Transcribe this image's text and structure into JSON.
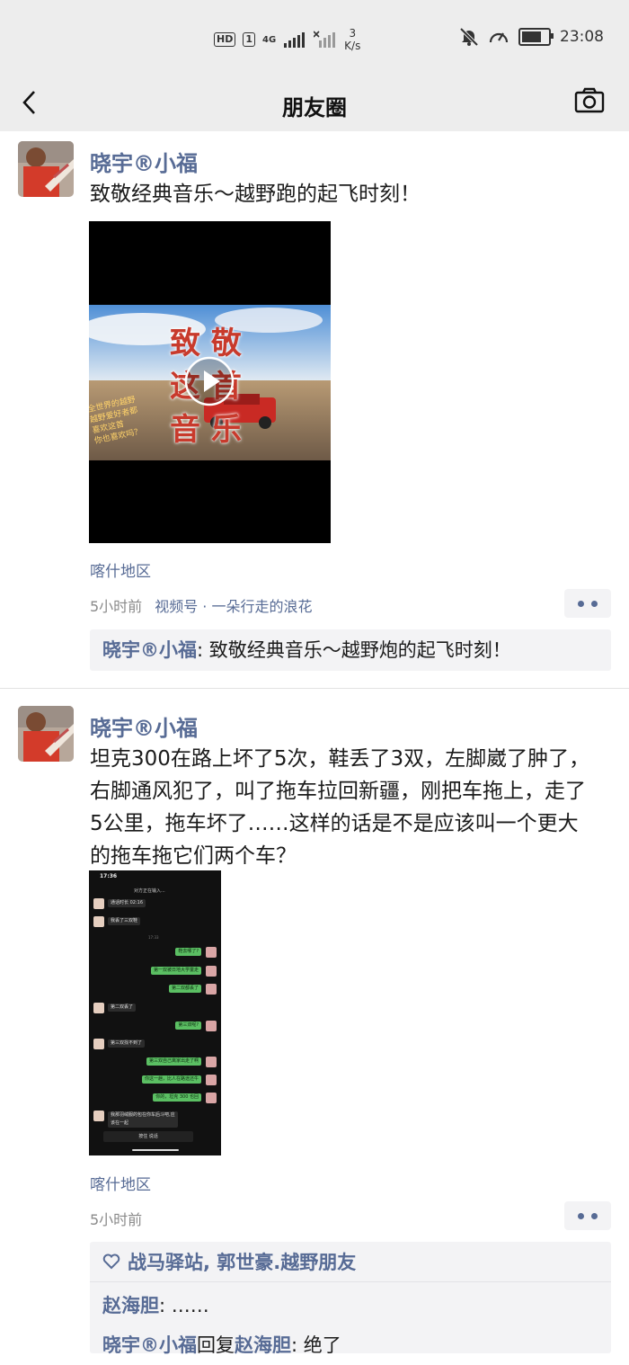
{
  "status_bar": {
    "hd": "HD",
    "sim": "1",
    "network": "4G",
    "speed_value": "3",
    "speed_unit": "K/s",
    "time": "23:08",
    "battery_level": 0.88
  },
  "nav": {
    "title": "朋友圈",
    "back_icon": "chevron-left-icon",
    "camera_icon": "camera-icon"
  },
  "posts": [
    {
      "author": "晓宇®小福",
      "text": "致敬经典音乐～越野跑的起飞时刻！",
      "video": {
        "overlay_text": "致 敬\n这 首\n音 乐",
        "side_text": "全世界的越野\n越野爱好者都\n喜欢这首\n你也喜欢吗？"
      },
      "location": "喀什地区",
      "time": "5小时前",
      "source": "视频号 · 一朵行走的浪花",
      "comments": [
        {
          "nick": "晓宇®小福",
          "sep": ": ",
          "content": "致敬经典音乐～越野炮的起飞时刻！"
        }
      ]
    },
    {
      "author": "晓宇®小福",
      "text": "坦克300在路上坏了5次，鞋丢了3双，左脚崴了肿了，右脚通风犯了，叫了拖车拉回新疆，刚把车拖上，走了5公里，拖车坏了……这样的话是不是应该叫一个更大的拖车拖它们两个车？",
      "screenshot": {
        "time": "17:36",
        "header": "对方正在输入...",
        "call": "通话时长 02:16",
        "divider_time": "17:33",
        "messages": [
          {
            "side": "in",
            "text": "我丢了三双鞋"
          },
          {
            "side": "out",
            "text": "鞋去哪了?"
          },
          {
            "side": "out",
            "text": "第一双被日地大学童走"
          },
          {
            "side": "out",
            "text": "第二双都丢了"
          },
          {
            "side": "in",
            "text": "第二双丢了"
          },
          {
            "side": "out",
            "text": "第三双呢?"
          },
          {
            "side": "in",
            "text": "第三双找不到了"
          },
          {
            "side": "out",
            "text": "第三双自己离家出走了啊"
          },
          {
            "side": "out",
            "text": "你这一趟，比人在路途还牛"
          },
          {
            "side": "out",
            "text": "你的，坦克 300 也回"
          },
          {
            "side": "in",
            "text": "我那羽绒服的包在你车后斗吧,应该在一起"
          }
        ],
        "input_hint": "按住 说话"
      },
      "location": "喀什地区",
      "time": "5小时前",
      "likes": "战马驿站, 郭世豪.越野朋友",
      "comments": [
        {
          "nick": "赵海胆",
          "sep": ": ",
          "content": "……"
        },
        {
          "nick": "晓宇®小福",
          "reply_word": "回复",
          "reply_to": "赵海胆",
          "sep": ": ",
          "content": "绝了"
        }
      ]
    }
  ],
  "colors": {
    "bar_bg": "#ededed",
    "link_blue": "#576b95",
    "wechat_green": "#5bbf63"
  }
}
